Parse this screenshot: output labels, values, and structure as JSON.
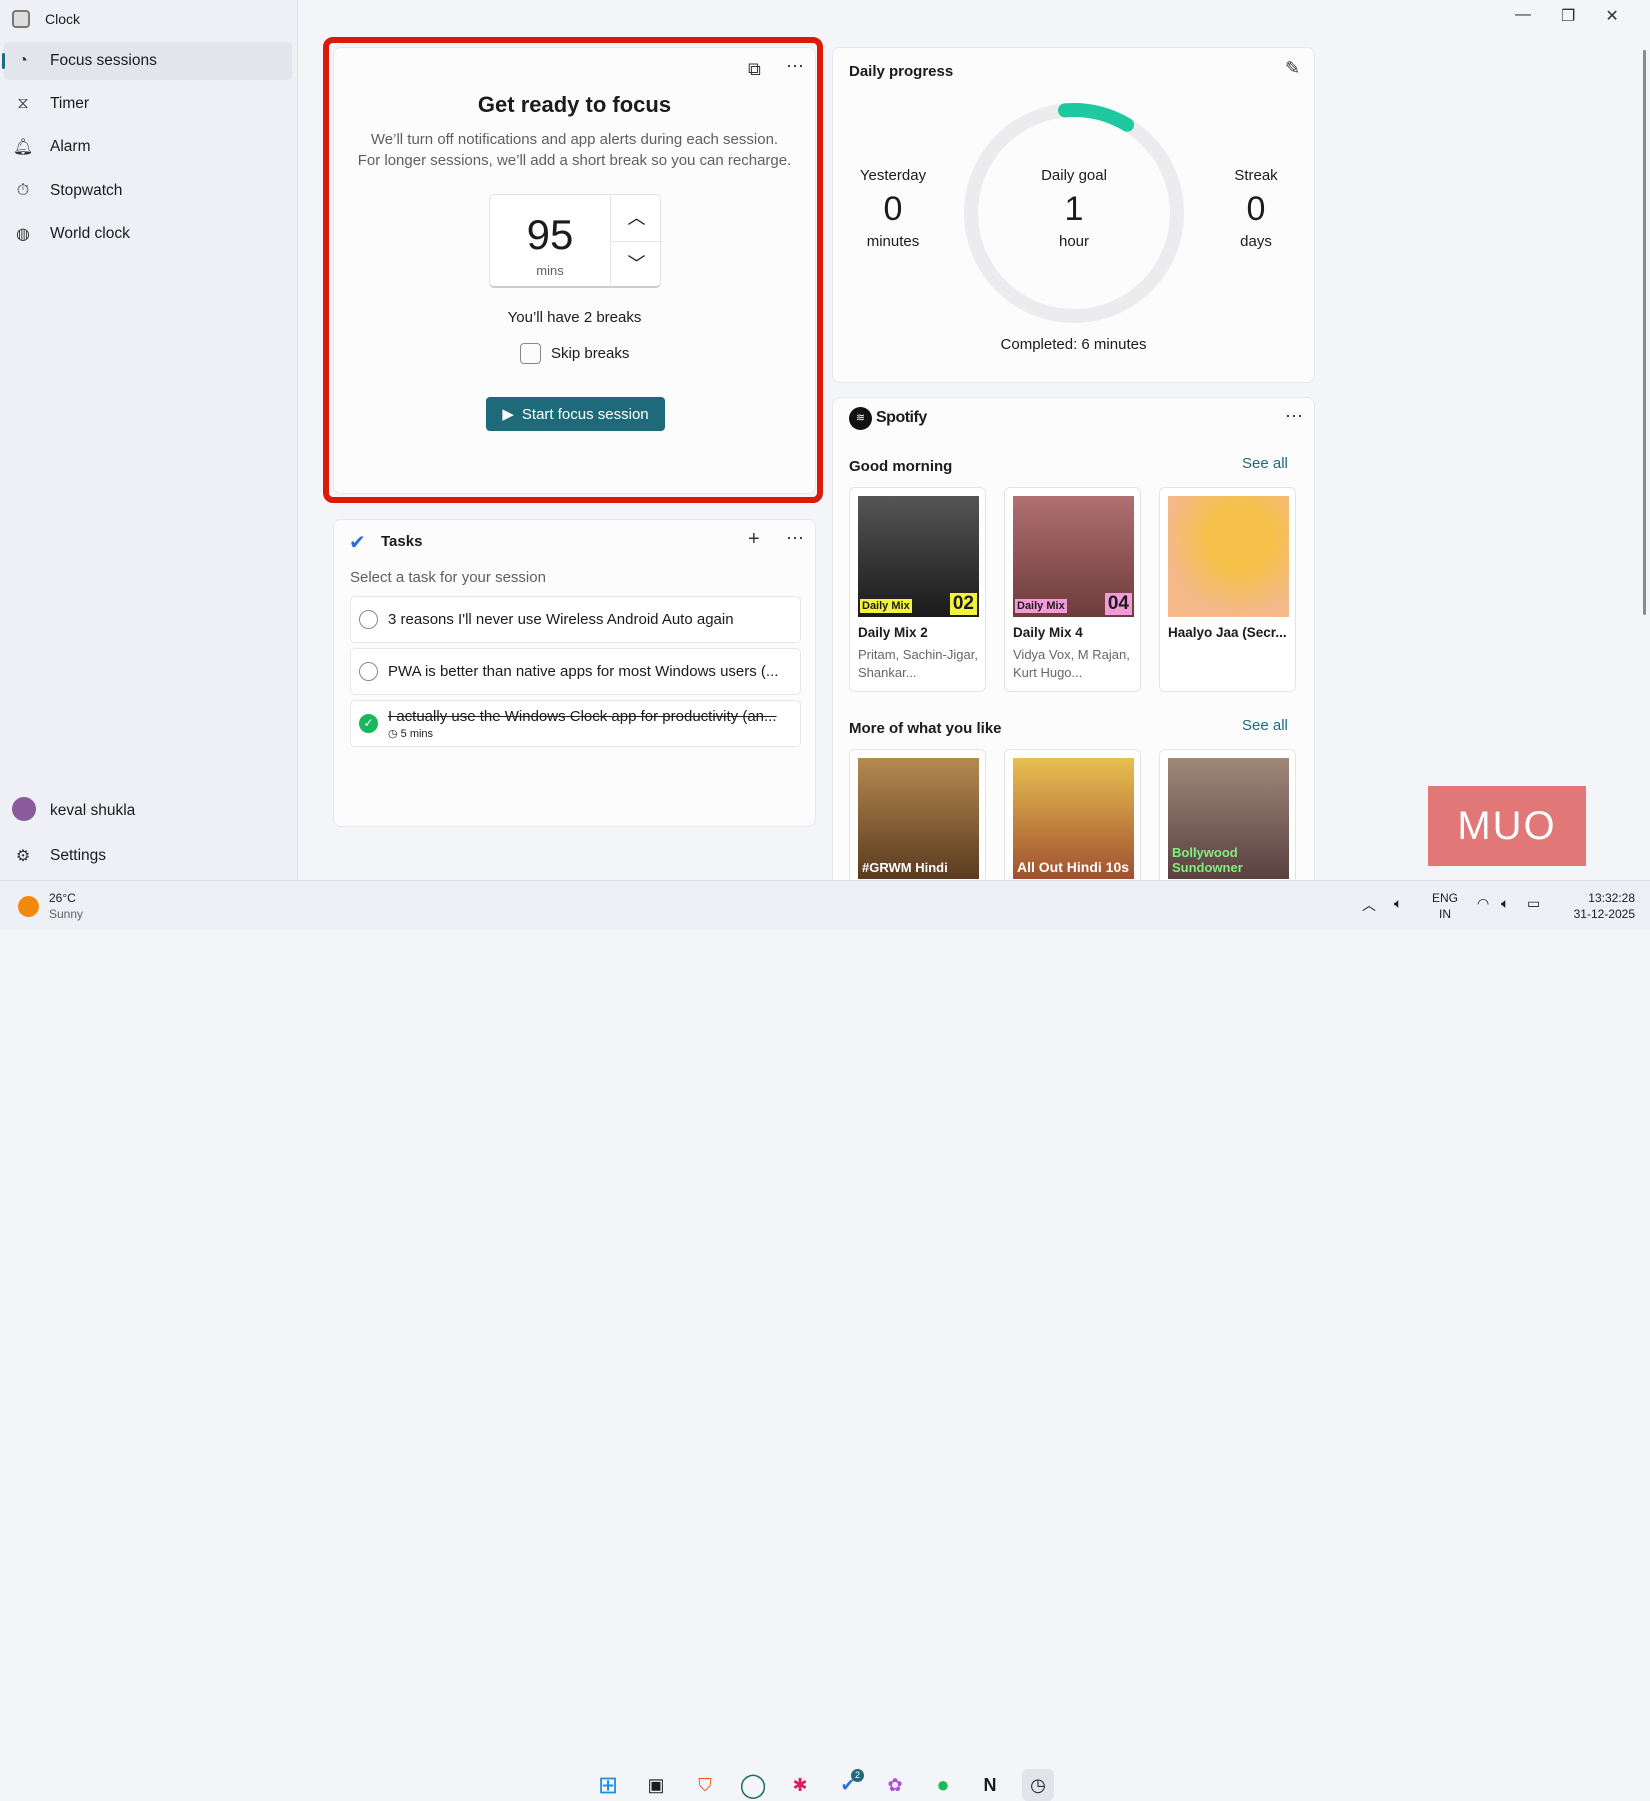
{
  "app": {
    "title": "Clock"
  },
  "sidebar": {
    "items": [
      {
        "label": "Focus sessions",
        "icon": "focus-icon"
      },
      {
        "label": "Timer",
        "icon": "hourglass-icon"
      },
      {
        "label": "Alarm",
        "icon": "bell-icon"
      },
      {
        "label": "Stopwatch",
        "icon": "stopwatch-icon"
      },
      {
        "label": "World clock",
        "icon": "globe-icon"
      }
    ],
    "user": "keval shukla",
    "settings": "Settings"
  },
  "focus": {
    "title": "Get ready to focus",
    "desc1": "We’ll turn off notifications and app alerts during each session.",
    "desc2": "For longer sessions, we’ll add a short break so you can recharge.",
    "minutes": "95",
    "unit": "mins",
    "breaks": "You’ll have 2 breaks",
    "skip": "Skip breaks",
    "start": "Start focus session"
  },
  "tasks": {
    "title": "Tasks",
    "prompt": "Select a task for your session",
    "items": [
      {
        "text": "3 reasons I'll never use Wireless Android Auto again",
        "done": false
      },
      {
        "text": "PWA is better than native apps for most Windows users (...",
        "done": false
      },
      {
        "text": "I actually use the Windows Clock app for productivity (an...",
        "done": true,
        "meta": "5 mins"
      }
    ]
  },
  "progress": {
    "title": "Daily progress",
    "yesterday_label": "Yesterday",
    "yesterday_value": "0",
    "yesterday_unit": "minutes",
    "goal_label": "Daily goal",
    "goal_value": "1",
    "goal_unit": "hour",
    "streak_label": "Streak",
    "streak_value": "0",
    "streak_unit": "days",
    "completed": "Completed: 6 minutes",
    "fraction": 0.1,
    "accent": "#1ec8a0"
  },
  "spotify": {
    "brand": "Spotify",
    "section1": "Good morning",
    "see_all": "See all",
    "section2": "More of what you like",
    "tiles": [
      {
        "title": "Daily Mix 2",
        "sub": "Pritam, Sachin-Jigar, Shankar...",
        "badge": "Daily Mix",
        "num": "02"
      },
      {
        "title": "Daily Mix 4",
        "sub": "Vidya Vox, M Rajan, Kurt Hugo...",
        "badge": "Daily Mix",
        "num": "04"
      },
      {
        "title": "Haalyo Jaa (Secr...",
        "sub": ""
      }
    ],
    "more": [
      "#GRWM Hindi",
      "All Out Hindi 10s",
      "Bollywood Sundowner"
    ]
  },
  "taskbar": {
    "temp": "26°C",
    "weather": "Sunny",
    "lang1": "ENG",
    "lang2": "IN",
    "time": "13:32:28",
    "date": "31-12-2025",
    "badge": "2"
  },
  "watermark": "MUO",
  "colors": {
    "accent": "#1e6a7a",
    "highlight": "#dd1a0a"
  }
}
